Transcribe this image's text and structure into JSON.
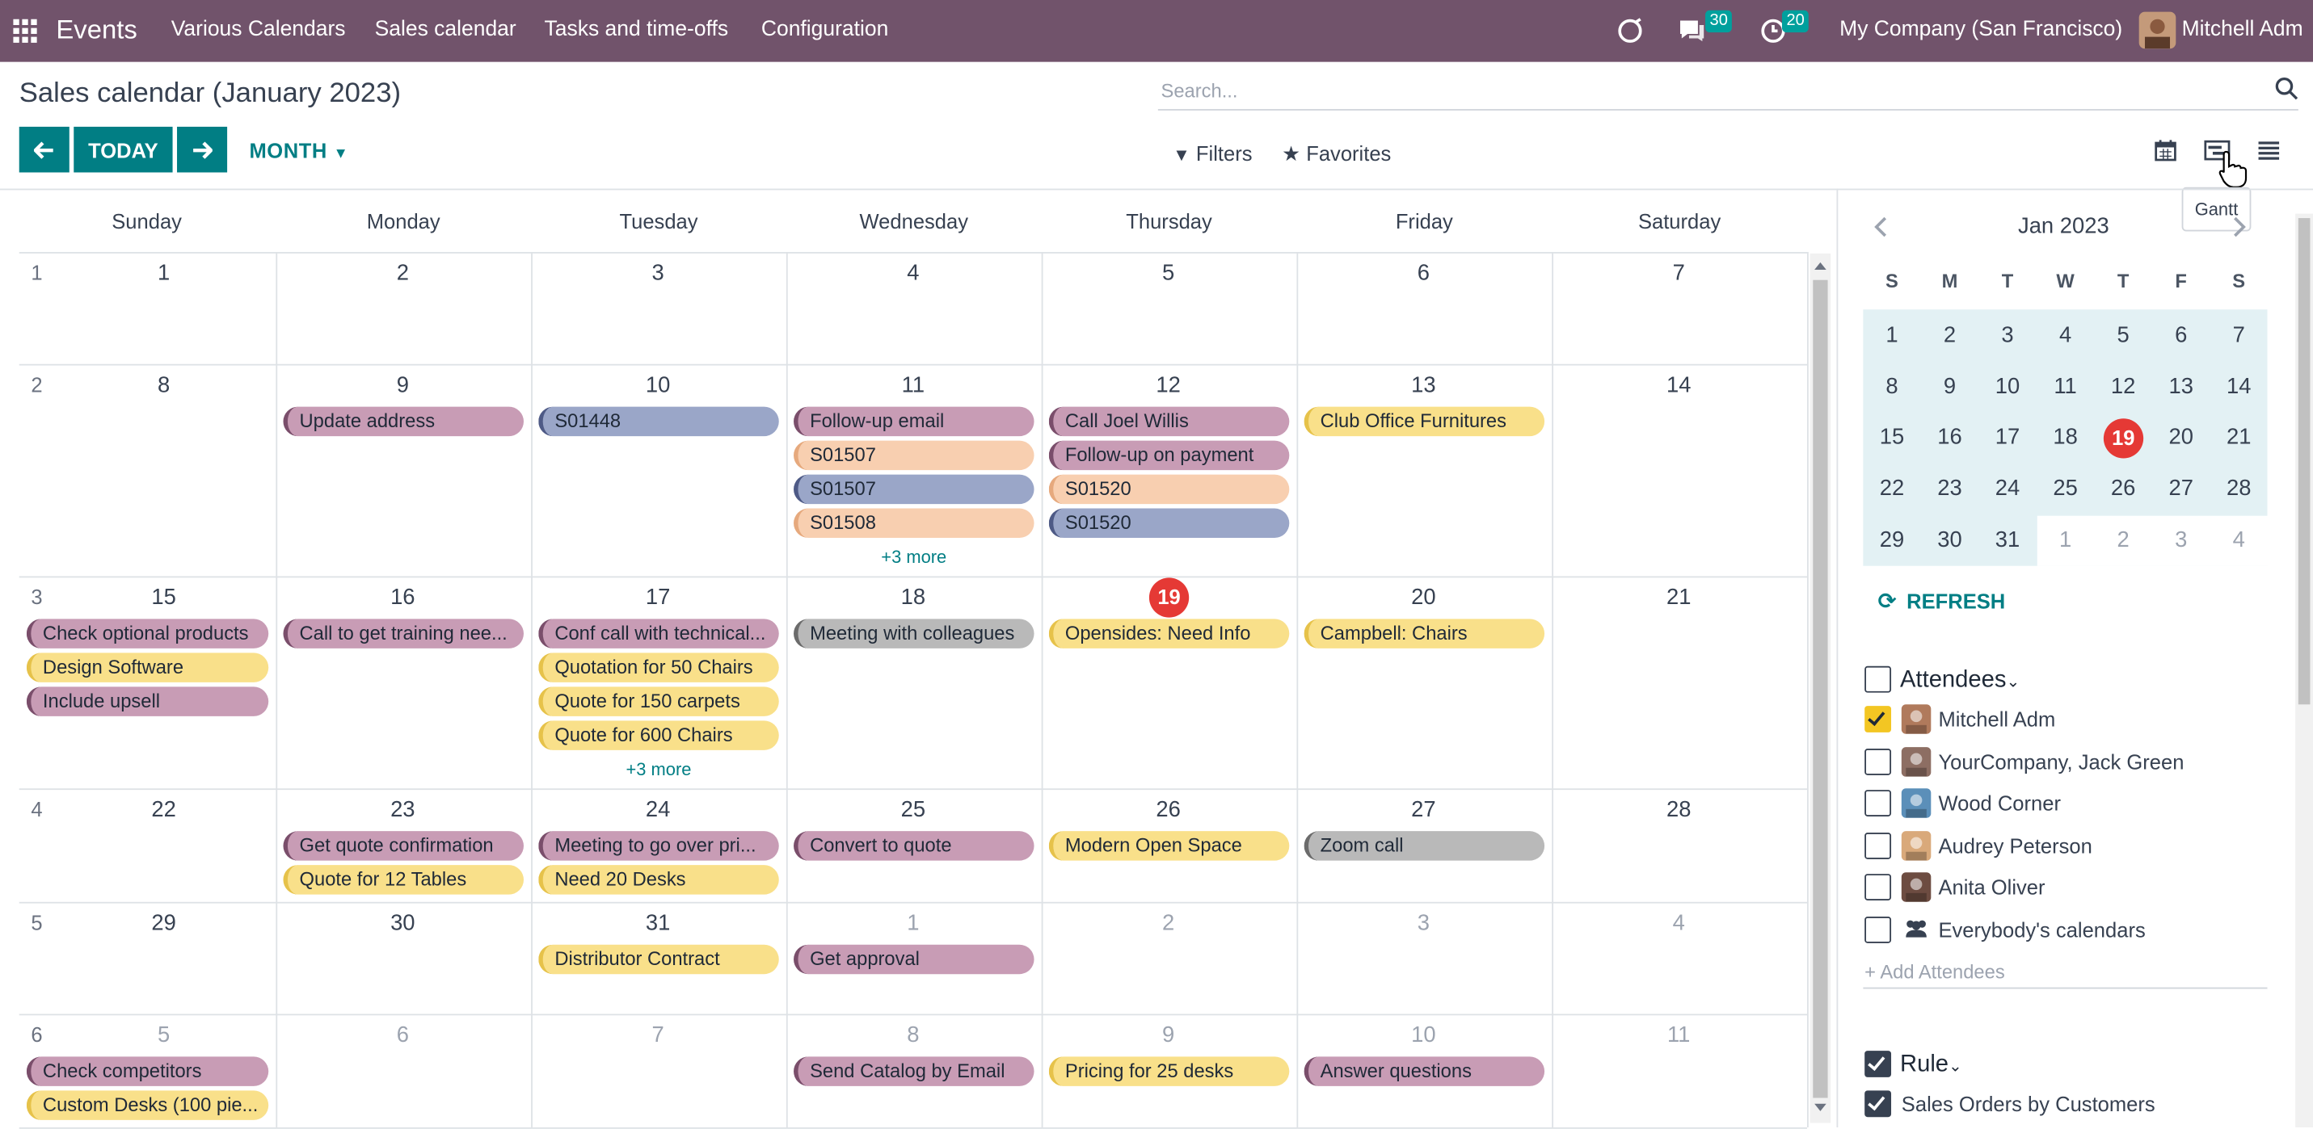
{
  "navbar": {
    "app_name": "Events",
    "menu": [
      "Various Calendars",
      "Sales calendar",
      "Tasks and time-offs",
      "Configuration"
    ],
    "messages_count": "30",
    "activities_count": "20",
    "company": "My Company (San Francisco)",
    "user": "Mitchell Adm"
  },
  "control_panel": {
    "title": "Sales calendar (January 2023)",
    "search_placeholder": "Search...",
    "today_label": "TODAY",
    "scale_label": "MONTH",
    "filters_label": "Filters",
    "favorites_label": "Favorites",
    "tooltip": "Gantt"
  },
  "calendar": {
    "day_names": [
      "Sunday",
      "Monday",
      "Tuesday",
      "Wednesday",
      "Thursday",
      "Friday",
      "Saturday"
    ],
    "week_numbers": [
      "1",
      "2",
      "3",
      "4",
      "5",
      "6"
    ],
    "weeks": [
      [
        "1",
        "2",
        "3",
        "4",
        "5",
        "6",
        "7"
      ],
      [
        "8",
        "9",
        "10",
        "11",
        "12",
        "13",
        "14"
      ],
      [
        "15",
        "16",
        "17",
        "18",
        "19",
        "20",
        "21"
      ],
      [
        "22",
        "23",
        "24",
        "25",
        "26",
        "27",
        "28"
      ],
      [
        "29",
        "30",
        "31",
        "1",
        "2",
        "3",
        "4"
      ],
      [
        "5",
        "6",
        "7",
        "8",
        "9",
        "10",
        "11"
      ]
    ],
    "events": [
      {
        "week": 1,
        "day": 1,
        "row": 0,
        "label": "Update address",
        "color": "pink"
      },
      {
        "week": 1,
        "day": 2,
        "row": 0,
        "label": "S01448",
        "color": "blue"
      },
      {
        "week": 1,
        "day": 3,
        "row": 0,
        "label": "Follow-up email",
        "color": "pink"
      },
      {
        "week": 1,
        "day": 3,
        "row": 1,
        "label": "S01507",
        "color": "peach"
      },
      {
        "week": 1,
        "day": 3,
        "row": 2,
        "label": "S01507",
        "color": "blue"
      },
      {
        "week": 1,
        "day": 3,
        "row": 3,
        "label": "S01508",
        "color": "peach"
      },
      {
        "week": 1,
        "day": 4,
        "row": 0,
        "label": "Call Joel Willis",
        "color": "pink"
      },
      {
        "week": 1,
        "day": 4,
        "row": 1,
        "label": "Follow-up on payment",
        "color": "pink"
      },
      {
        "week": 1,
        "day": 4,
        "row": 2,
        "label": "S01520",
        "color": "peach"
      },
      {
        "week": 1,
        "day": 4,
        "row": 3,
        "label": "S01520",
        "color": "blue"
      },
      {
        "week": 1,
        "day": 5,
        "row": 0,
        "label": "Club Office Furnitures",
        "color": "yellow"
      },
      {
        "week": 2,
        "day": 0,
        "row": 0,
        "label": "Check optional products",
        "color": "pink"
      },
      {
        "week": 2,
        "day": 0,
        "row": 1,
        "label": "Design Software",
        "color": "yellow"
      },
      {
        "week": 2,
        "day": 0,
        "row": 2,
        "label": "Include upsell",
        "color": "pink"
      },
      {
        "week": 2,
        "day": 1,
        "row": 0,
        "label": "Call to get training nee...",
        "color": "pink"
      },
      {
        "week": 2,
        "day": 2,
        "row": 0,
        "label": "Conf call with technical...",
        "color": "pink"
      },
      {
        "week": 2,
        "day": 2,
        "row": 1,
        "label": "Quotation for 50 Chairs",
        "color": "yellow"
      },
      {
        "week": 2,
        "day": 2,
        "row": 2,
        "label": "Quote for 150 carpets",
        "color": "yellow"
      },
      {
        "week": 2,
        "day": 2,
        "row": 3,
        "label": "Quote for 600 Chairs",
        "color": "yellow"
      },
      {
        "week": 2,
        "day": 3,
        "row": 0,
        "label": "Meeting with colleagues",
        "color": "grey"
      },
      {
        "week": 2,
        "day": 4,
        "row": 0,
        "label": "Opensides: Need Info",
        "color": "yellow"
      },
      {
        "week": 2,
        "day": 5,
        "row": 0,
        "label": "Campbell: Chairs",
        "color": "yellow"
      },
      {
        "week": 3,
        "day": 1,
        "row": 0,
        "label": "Get quote confirmation",
        "color": "pink"
      },
      {
        "week": 3,
        "day": 1,
        "row": 1,
        "label": "Quote for 12 Tables",
        "color": "yellow"
      },
      {
        "week": 3,
        "day": 2,
        "row": 0,
        "label": "Meeting to go over pri...",
        "color": "pink"
      },
      {
        "week": 3,
        "day": 2,
        "row": 1,
        "label": "Need 20 Desks",
        "color": "yellow"
      },
      {
        "week": 3,
        "day": 3,
        "row": 0,
        "label": "Convert to quote",
        "color": "pink"
      },
      {
        "week": 3,
        "day": 4,
        "row": 0,
        "label": "Modern Open Space",
        "color": "yellow"
      },
      {
        "week": 3,
        "day": 5,
        "row": 0,
        "label": "Zoom call",
        "color": "grey"
      },
      {
        "week": 4,
        "day": 2,
        "row": 0,
        "label": "Distributor Contract",
        "color": "yellow"
      },
      {
        "week": 4,
        "day": 3,
        "row": 0,
        "label": "Get approval",
        "color": "pink"
      },
      {
        "week": 5,
        "day": 0,
        "row": 0,
        "label": "Check competitors",
        "color": "pink"
      },
      {
        "week": 5,
        "day": 0,
        "row": 1,
        "label": "Custom Desks (100 pie...",
        "color": "yellow"
      },
      {
        "week": 5,
        "day": 3,
        "row": 0,
        "label": "Send Catalog by Email",
        "color": "pink"
      },
      {
        "week": 5,
        "day": 4,
        "row": 0,
        "label": "Pricing for 25 desks",
        "color": "yellow"
      },
      {
        "week": 5,
        "day": 5,
        "row": 0,
        "label": "Answer questions",
        "color": "pink"
      }
    ],
    "more_links": [
      {
        "week": 1,
        "day": 3,
        "label": "+3 more"
      },
      {
        "week": 2,
        "day": 2,
        "label": "+3 more"
      }
    ],
    "today": "19"
  },
  "sidebar": {
    "month_title": "Jan 2023",
    "dow": [
      "S",
      "M",
      "T",
      "W",
      "T",
      "F",
      "S"
    ],
    "mini_weeks": [
      [
        "1",
        "2",
        "3",
        "4",
        "5",
        "6",
        "7"
      ],
      [
        "8",
        "9",
        "10",
        "11",
        "12",
        "13",
        "14"
      ],
      [
        "15",
        "16",
        "17",
        "18",
        "19",
        "20",
        "21"
      ],
      [
        "22",
        "23",
        "24",
        "25",
        "26",
        "27",
        "28"
      ],
      [
        "29",
        "30",
        "31",
        "1",
        "2",
        "3",
        "4"
      ]
    ],
    "refresh_label": "REFRESH",
    "attendees_title": "Attendees",
    "attendees": [
      {
        "name": "Mitchell Adm",
        "checked": true
      },
      {
        "name": "YourCompany, Jack Green",
        "checked": false
      },
      {
        "name": "Wood Corner",
        "checked": false
      },
      {
        "name": "Audrey Peterson",
        "checked": false
      },
      {
        "name": "Anita Oliver",
        "checked": false
      },
      {
        "name": "Everybody's calendars",
        "checked": false
      }
    ],
    "add_attendees_placeholder": "+ Add Attendees",
    "rule_title": "Rule",
    "rule_items": [
      {
        "name": "Sales Orders by Customers",
        "checked": true
      }
    ]
  },
  "colors": {
    "navbar": "#71536b",
    "accent": "#017e84",
    "today": "#e53935",
    "pink": "#c89cb5",
    "yellow": "#f9e08a",
    "blue": "#9aa6c8",
    "peach": "#f8cfb0",
    "grey": "#b9b9b9"
  }
}
